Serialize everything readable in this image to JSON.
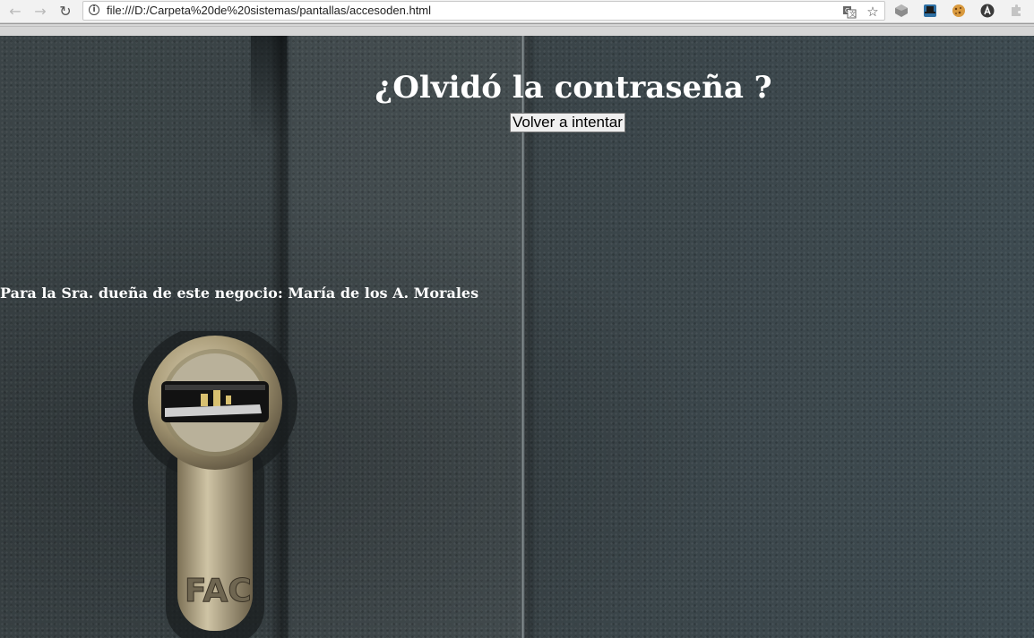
{
  "browser": {
    "url": "file:///D:/Carpeta%20de%20sistemas/pantallas/accesoden.html",
    "back_icon": "arrow-left-icon",
    "forward_icon": "arrow-right-icon",
    "reload_icon": "reload-icon",
    "info_glyph": "i",
    "extensions": [
      "translate-icon",
      "star-icon",
      "extension-cube-icon",
      "extension-hat-icon",
      "cookie-icon",
      "extension-a-icon",
      "puzzle-icon"
    ]
  },
  "page": {
    "title": "¿Olvidó la contraseña ?",
    "retry_button": "Volver a intentar",
    "dedication": "Para la Sra. dueña de este negocio: María de los A. Morales",
    "lock_brand": "FAC"
  },
  "colors": {
    "text": "#ffffff",
    "background": "#3b4447",
    "button_bg": "#efefef"
  }
}
